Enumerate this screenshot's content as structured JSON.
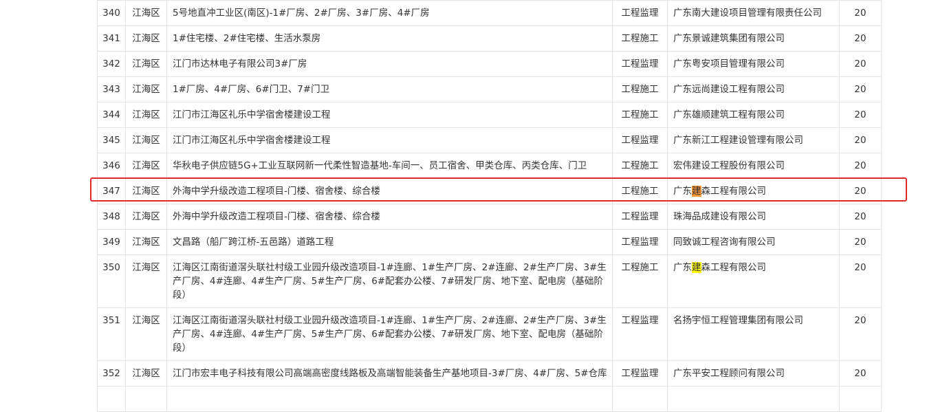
{
  "table": {
    "rows": [
      {
        "no": "340",
        "area": "江海区",
        "name": "5号地直冲工业区(南区)-1#厂房、2#厂房、3#厂房、4#厂房",
        "type": "工程监理",
        "company_pre": "广东南大建设项目管理有限责任公司",
        "company_hl": "",
        "company_post": "",
        "score": "20"
      },
      {
        "no": "341",
        "area": "江海区",
        "name": "1#住宅楼、2#住宅楼、生活水泵房",
        "type": "工程施工",
        "company_pre": "广东景诚建筑集团有限公司",
        "company_hl": "",
        "company_post": "",
        "score": "20"
      },
      {
        "no": "342",
        "area": "江海区",
        "name": "江门市达林电子有限公司3#厂房",
        "type": "工程监理",
        "company_pre": "广东粤安项目管理有限公司",
        "company_hl": "",
        "company_post": "",
        "score": "20"
      },
      {
        "no": "343",
        "area": "江海区",
        "name": "1#厂房、4#厂房、6#门卫、7#门卫",
        "type": "工程施工",
        "company_pre": "广东远尚建设工程有限公司",
        "company_hl": "",
        "company_post": "",
        "score": "20"
      },
      {
        "no": "344",
        "area": "江海区",
        "name": "江门市江海区礼乐中学宿舍楼建设工程",
        "type": "工程施工",
        "company_pre": "广东雄顺建筑工程有限公司",
        "company_hl": "",
        "company_post": "",
        "score": "20"
      },
      {
        "no": "345",
        "area": "江海区",
        "name": "江门市江海区礼乐中学宿舍楼建设工程",
        "type": "工程监理",
        "company_pre": "广东新江工程建设管理有限公司",
        "company_hl": "",
        "company_post": "",
        "score": "20"
      },
      {
        "no": "346",
        "area": "江海区",
        "name": "华秋电子供应链5G+工业互联网新一代柔性智造基地-车间一、员工宿舍、甲类仓库、丙类仓库、门卫",
        "type": "工程施工",
        "company_pre": "宏伟建设工程股份有限公司",
        "company_hl": "",
        "company_post": "",
        "score": "20"
      },
      {
        "no": "347",
        "area": "江海区",
        "name": "外海中学升级改造工程项目-门楼、宿舍楼、综合楼",
        "type": "工程施工",
        "company_pre": "广东",
        "company_hl": "建",
        "company_post": "森工程有限公司",
        "score": "20"
      },
      {
        "no": "348",
        "area": "江海区",
        "name": "外海中学升级改造工程项目-门楼、宿舍楼、综合楼",
        "type": "工程监理",
        "company_pre": "珠海品成建设有限公司",
        "company_hl": "",
        "company_post": "",
        "score": "20"
      },
      {
        "no": "349",
        "area": "江海区",
        "name": "文昌路（船厂跨江桥-五邑路）道路工程",
        "type": "工程监理",
        "company_pre": "同致诚工程咨询有限公司",
        "company_hl": "",
        "company_post": "",
        "score": "20"
      },
      {
        "no": "350",
        "area": "江海区",
        "name": "江海区江南街道滘头联社村级工业园升级改造项目-1#连廊、1#生产厂房、2#连廊、2#生产厂房、3#生产厂房、4#连廊、4#生产厂房、5#生产厂房、6#配套办公楼、7#研发厂房、地下室、配电房（基础阶段）",
        "type": "工程施工",
        "company_pre": "广东",
        "company_hl": "建",
        "company_post": "森工程有限公司",
        "score": "20"
      },
      {
        "no": "351",
        "area": "江海区",
        "name": "江海区江南街道滘头联社村级工业园升级改造项目-1#连廊、1#生产厂房、2#连廊、2#生产厂房、3#生产厂房、4#连廊、4#生产厂房、5#生产厂房、6#配套办公楼、7#研发厂房、地下室、配电房（基础阶段）",
        "type": "工程监理",
        "company_pre": "名扬宇恒工程管理集团有限公司",
        "company_hl": "",
        "company_post": "",
        "score": "20"
      },
      {
        "no": "352",
        "area": "江海区",
        "name": "江门市宏丰电子科技有限公司高端高密度线路板及高端智能装备生产基地项目-3#厂房、4#厂房、5#仓库",
        "type": "工程监理",
        "company_pre": "广东平安工程顾问有限公司",
        "company_hl": "",
        "company_post": "",
        "score": "20"
      }
    ]
  },
  "colors": {
    "text": "#333333",
    "border": "#e4e4e4",
    "highlight_box": "#e0282a",
    "highlight_current": "#ff9632",
    "highlight_match": "#ffff00"
  }
}
